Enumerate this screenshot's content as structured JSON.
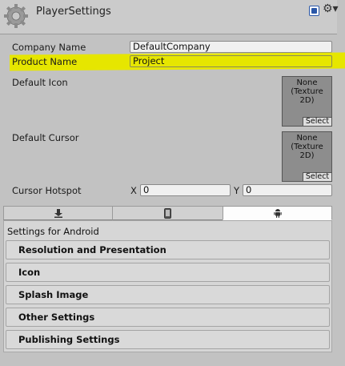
{
  "window": {
    "title": "PlayerSettings"
  },
  "header": {
    "help_icon": "help-book-icon",
    "settings_icon": "gear-menu-icon"
  },
  "properties": {
    "company_name": {
      "label": "Company Name",
      "value": "DefaultCompany"
    },
    "product_name": {
      "label": "Product Name",
      "value": "Project"
    },
    "default_icon": {
      "label": "Default Icon",
      "texture_line1": "None",
      "texture_line2": "(Texture",
      "texture_line3": "2D)",
      "select_label": "Select"
    },
    "default_cursor": {
      "label": "Default Cursor",
      "texture_line1": "None",
      "texture_line2": "(Texture",
      "texture_line3": "2D)",
      "select_label": "Select"
    },
    "cursor_hotspot": {
      "label": "Cursor Hotspot",
      "x_label": "X",
      "x_value": "0",
      "y_label": "Y",
      "y_value": "0"
    }
  },
  "platform_tabs": [
    {
      "icon": "download-arrow-icon",
      "active": false
    },
    {
      "icon": "mobile-device-icon",
      "active": false
    },
    {
      "icon": "android-icon",
      "active": true
    }
  ],
  "android": {
    "heading": "Settings for Android",
    "sections": [
      "Resolution and Presentation",
      "Icon",
      "Splash Image",
      "Other Settings",
      "Publishing Settings"
    ]
  },
  "colors": {
    "highlight": "#e6e600",
    "background": "#c2c2c2"
  }
}
